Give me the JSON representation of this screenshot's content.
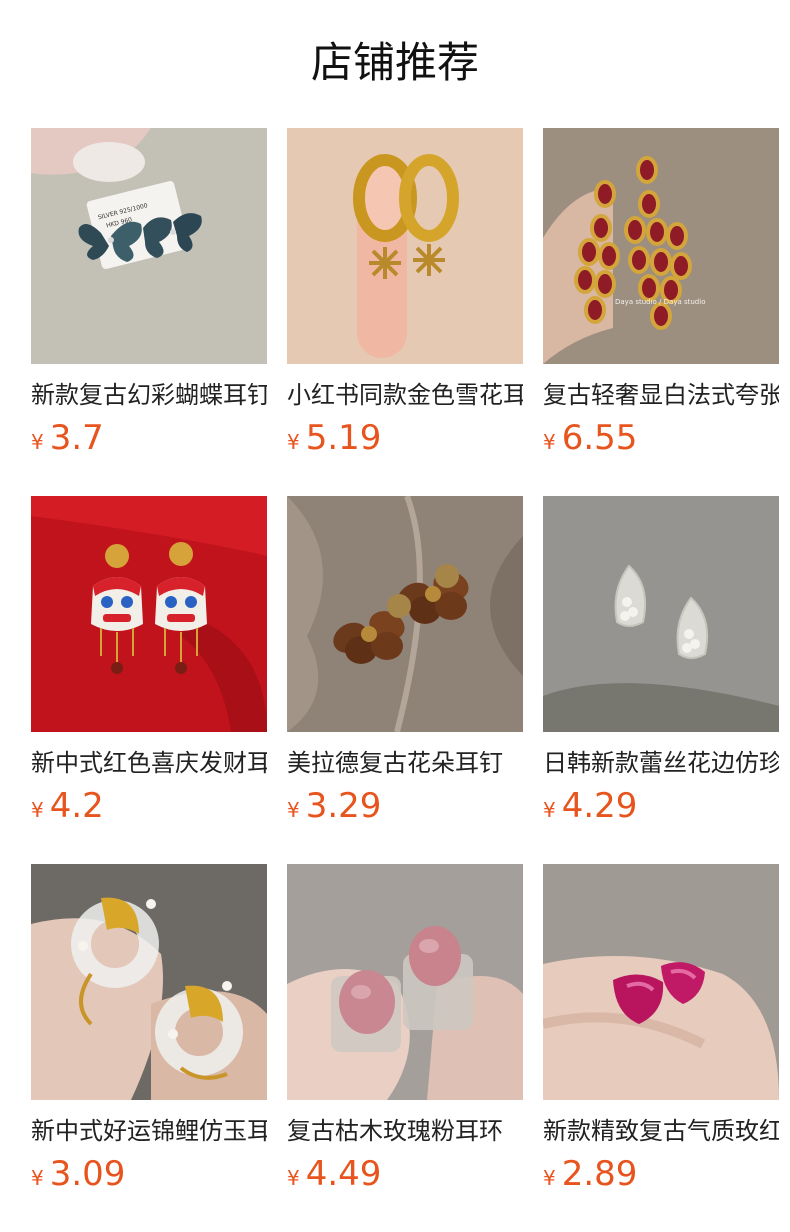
{
  "title": "店铺推荐",
  "currency": "¥",
  "products": [
    {
      "name": "新款复古幻彩蝴蝶耳钉",
      "price": "3.7",
      "image": "butterfly-earrings",
      "tag_text": [
        "SILVER 925/1000",
        "HKD 960"
      ]
    },
    {
      "name": "小红书同款金色雪花耳环",
      "price": "5.19",
      "image": "gold-snowflake-hoops"
    },
    {
      "name": "复古轻奢显白法式夸张耳环",
      "price": "6.55",
      "image": "red-enamel-chandelier",
      "watermark": "Daya studio  /  Daya studio"
    },
    {
      "name": "新中式红色喜庆发财耳环",
      "price": "4.2",
      "image": "lion-dance-earrings"
    },
    {
      "name": "美拉德复古花朵耳钉",
      "price": "3.29",
      "image": "brown-flower-studs"
    },
    {
      "name": "日韩新款蕾丝花边仿珍珠耳钉",
      "price": "4.29",
      "image": "lace-pearl-studs"
    },
    {
      "name": "新中式好运锦鲤仿玉耳环",
      "price": "3.09",
      "image": "koi-jade-earrings"
    },
    {
      "name": "复古枯木玫瑰粉耳环",
      "price": "4.49",
      "image": "pink-oval-studs"
    },
    {
      "name": "新款精致复古气质玫红耳钉",
      "price": "2.89",
      "image": "magenta-triangle-studs"
    }
  ],
  "colors": {
    "price": "#e8541e",
    "title": "#111111"
  }
}
